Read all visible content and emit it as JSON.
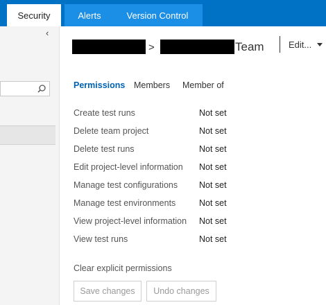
{
  "tabs": [
    {
      "label": "Security",
      "active": true
    },
    {
      "label": "Alerts",
      "active": false
    },
    {
      "label": "Version Control",
      "active": false
    }
  ],
  "header": {
    "separator": ">",
    "team_suffix": "Team",
    "edit_label": "Edit..."
  },
  "subtabs": [
    {
      "label": "Permissions",
      "active": true
    },
    {
      "label": "Members",
      "active": false
    },
    {
      "label": "Member of",
      "active": false
    }
  ],
  "permissions": [
    {
      "name": "Create test runs",
      "value": "Not set"
    },
    {
      "name": "Delete team project",
      "value": "Not set"
    },
    {
      "name": "Delete test runs",
      "value": "Not set"
    },
    {
      "name": "Edit project-level information",
      "value": "Not set"
    },
    {
      "name": "Manage test configurations",
      "value": "Not set"
    },
    {
      "name": "Manage test environments",
      "value": "Not set"
    },
    {
      "name": "View project-level information",
      "value": "Not set"
    },
    {
      "name": "View test runs",
      "value": "Not set"
    }
  ],
  "clear_label": "Clear explicit permissions",
  "buttons": {
    "save": "Save changes",
    "undo": "Undo changes"
  },
  "colors": {
    "tabbar": "#0072c6",
    "tab_inactive": "#1b8ee6",
    "accent": "#0062b2"
  }
}
